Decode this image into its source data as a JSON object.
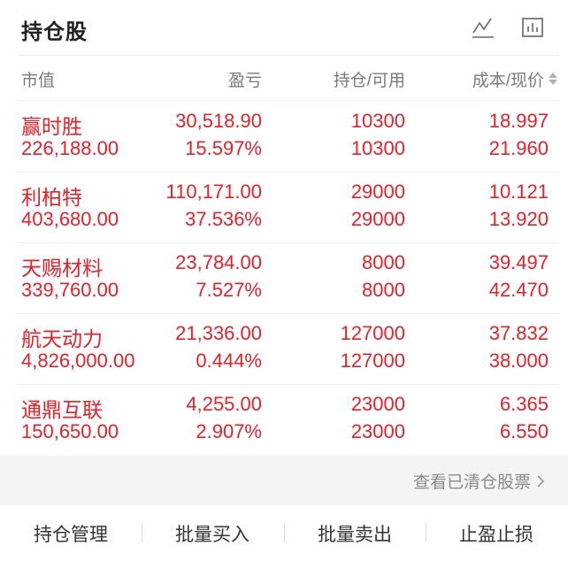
{
  "header": {
    "title": "持仓股",
    "icons": [
      "trend-line-icon",
      "bar-chart-icon"
    ]
  },
  "columns": {
    "market_value": "市值",
    "profit_loss": "盈亏",
    "position_available": "持仓/可用",
    "cost_price": "成本/现价"
  },
  "holdings": [
    {
      "name": "赢时胜",
      "market_value": "226,188.00",
      "profit": "30,518.90",
      "profit_pct": "15.597%",
      "position": "10300",
      "available": "10300",
      "cost": "18.997",
      "price": "21.960"
    },
    {
      "name": "利柏特",
      "market_value": "403,680.00",
      "profit": "110,171.00",
      "profit_pct": "37.536%",
      "position": "29000",
      "available": "29000",
      "cost": "10.121",
      "price": "13.920"
    },
    {
      "name": "天赐材料",
      "market_value": "339,760.00",
      "profit": "23,784.00",
      "profit_pct": "7.527%",
      "position": "8000",
      "available": "8000",
      "cost": "39.497",
      "price": "42.470"
    },
    {
      "name": "航天动力",
      "market_value": "4,826,000.00",
      "profit": "21,336.00",
      "profit_pct": "0.444%",
      "position": "127000",
      "available": "127000",
      "cost": "37.832",
      "price": "38.000"
    },
    {
      "name": "通鼎互联",
      "market_value": "150,650.00",
      "profit": "4,255.00",
      "profit_pct": "2.907%",
      "position": "23000",
      "available": "23000",
      "cost": "6.365",
      "price": "6.550"
    }
  ],
  "footer_link": "查看已清仓股票",
  "actions": [
    "持仓管理",
    "批量买入",
    "批量卖出",
    "止盈止损"
  ],
  "colors": {
    "gain": "#e8202a",
    "muted": "#7a7a7a",
    "band": "#f4f4f4"
  }
}
